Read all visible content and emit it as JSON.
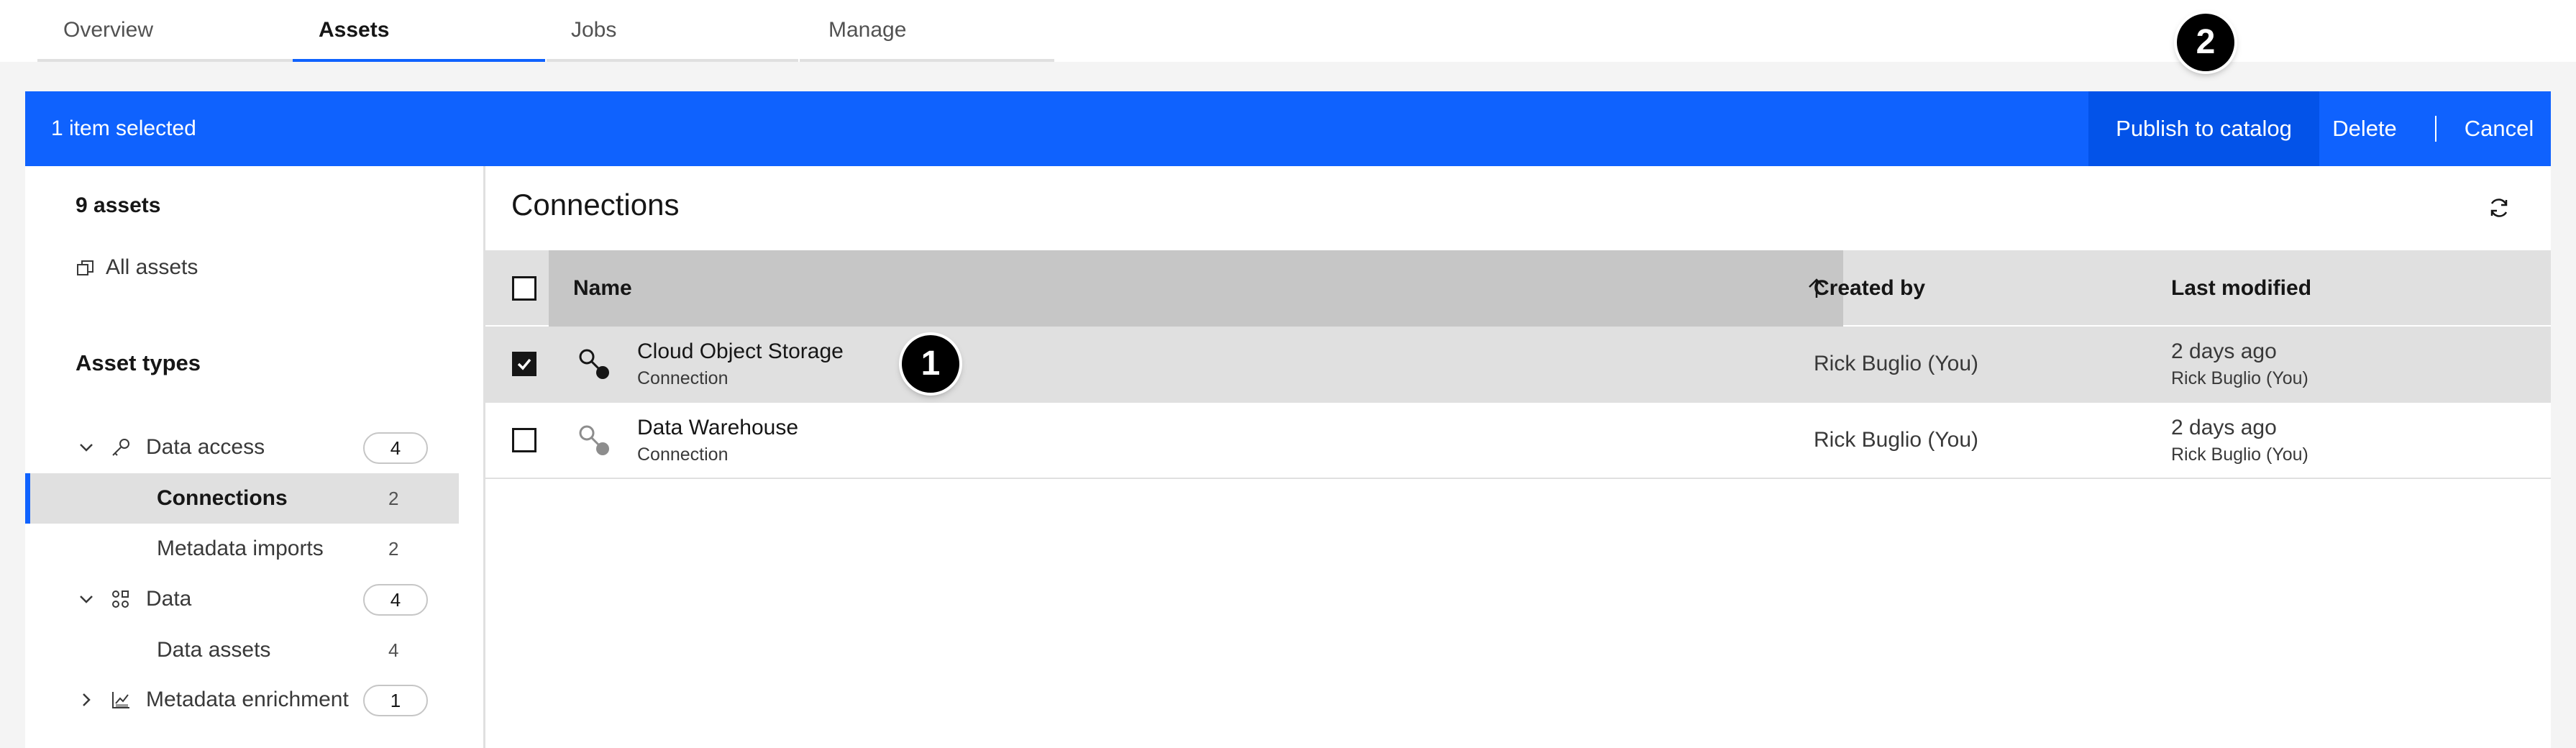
{
  "tabs": [
    {
      "label": "Overview"
    },
    {
      "label": "Assets"
    },
    {
      "label": "Jobs"
    },
    {
      "label": "Manage"
    }
  ],
  "banner": {
    "selected_text": "1 item selected",
    "publish_label": "Publish to catalog",
    "delete_label": "Delete",
    "cancel_label": "Cancel",
    "color": "#0f62fe"
  },
  "sidebar": {
    "asset_count": "9 assets",
    "all_assets_label": "All assets",
    "types_heading": "Asset types",
    "groups": [
      {
        "label": "Data access",
        "count": "4",
        "icon": "key-icon",
        "expanded": true
      },
      {
        "label": "Data",
        "count": "4",
        "icon": "data-icon",
        "expanded": true
      },
      {
        "label": "Metadata enrichment",
        "count": "1",
        "icon": "chart-icon",
        "expanded": false
      }
    ],
    "subitems": [
      {
        "label": "Connections",
        "count": "2"
      },
      {
        "label": "Metadata imports",
        "count": "2"
      },
      {
        "label": "Data assets",
        "count": "4"
      }
    ]
  },
  "main": {
    "title": "Connections",
    "columns": {
      "name": "Name",
      "created_by": "Created by",
      "last_modified": "Last modified"
    },
    "rows": [
      {
        "name": "Cloud Object Storage",
        "type": "Connection",
        "created_by": "Rick Buglio (You)",
        "modified": "2 days ago",
        "modified_by": "Rick Buglio (You)",
        "selected": true
      },
      {
        "name": "Data Warehouse",
        "type": "Connection",
        "created_by": "Rick Buglio (You)",
        "modified": "2 days ago",
        "modified_by": "Rick Buglio (You)",
        "selected": false
      }
    ]
  },
  "callouts": [
    "1",
    "2"
  ]
}
